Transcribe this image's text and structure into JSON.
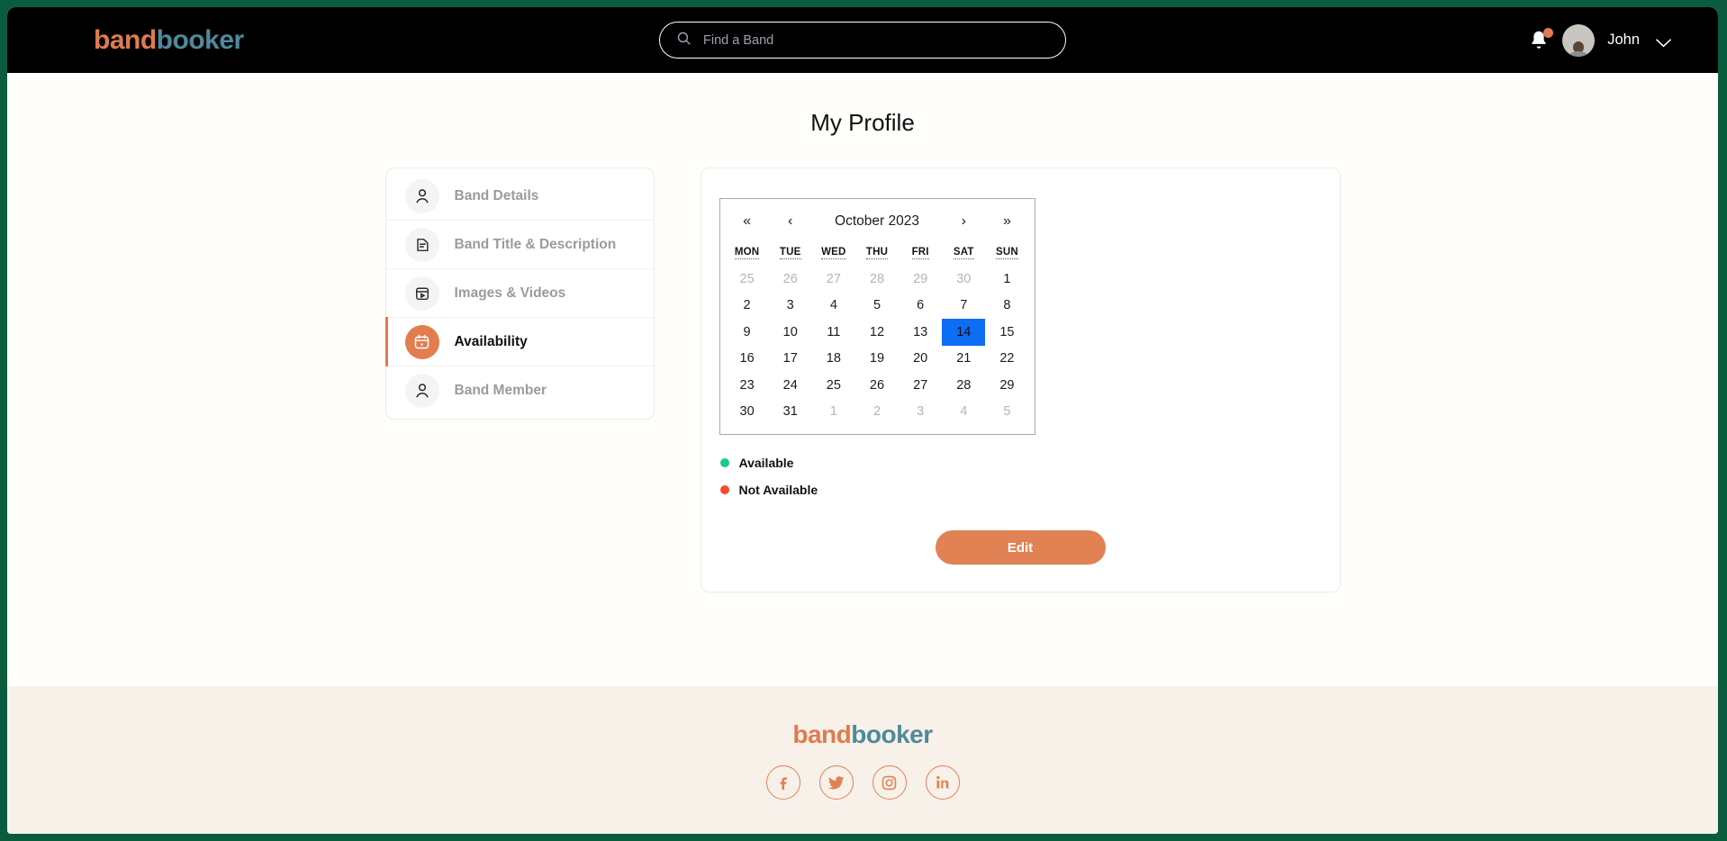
{
  "header": {
    "logo": {
      "part1": "band",
      "part2": "booker"
    },
    "search": {
      "value": "",
      "placeholder": "Find a Band"
    },
    "bell_icon": "bell-icon",
    "notification_dot": true,
    "username": "John",
    "chevron_icon": "chevron-down-icon"
  },
  "page": {
    "title": "My Profile"
  },
  "sidebar": {
    "items": [
      {
        "label": "Band Details",
        "icon": "user-icon",
        "active": false
      },
      {
        "label": "Band Title & Description",
        "icon": "document-icon",
        "active": false
      },
      {
        "label": "Images & Videos",
        "icon": "media-calendar-icon",
        "active": false
      },
      {
        "label": "Availability",
        "icon": "calendar-icon",
        "active": true
      },
      {
        "label": "Band Member",
        "icon": "user-icon",
        "active": false
      }
    ]
  },
  "calendar": {
    "nav": {
      "first": "«",
      "prev": "‹",
      "next": "›",
      "last": "»"
    },
    "month_label": "October 2023",
    "weekdays": [
      "MON",
      "TUE",
      "WED",
      "THU",
      "FRI",
      "SAT",
      "SUN"
    ],
    "selected_day": 14,
    "selected_color": "#0B6EF5",
    "weeks": [
      [
        {
          "d": "25",
          "muted": true
        },
        {
          "d": "26",
          "muted": true
        },
        {
          "d": "27",
          "muted": true
        },
        {
          "d": "28",
          "muted": true
        },
        {
          "d": "29",
          "muted": true
        },
        {
          "d": "30",
          "muted": true
        },
        {
          "d": "1",
          "muted": false
        }
      ],
      [
        {
          "d": "2",
          "muted": false
        },
        {
          "d": "3",
          "muted": false
        },
        {
          "d": "4",
          "muted": false
        },
        {
          "d": "5",
          "muted": false
        },
        {
          "d": "6",
          "muted": false
        },
        {
          "d": "7",
          "muted": false
        },
        {
          "d": "8",
          "muted": false
        }
      ],
      [
        {
          "d": "9",
          "muted": false
        },
        {
          "d": "10",
          "muted": false
        },
        {
          "d": "11",
          "muted": false
        },
        {
          "d": "12",
          "muted": false
        },
        {
          "d": "13",
          "muted": false
        },
        {
          "d": "14",
          "muted": false,
          "selected": true
        },
        {
          "d": "15",
          "muted": false
        }
      ],
      [
        {
          "d": "16",
          "muted": false
        },
        {
          "d": "17",
          "muted": false
        },
        {
          "d": "18",
          "muted": false
        },
        {
          "d": "19",
          "muted": false
        },
        {
          "d": "20",
          "muted": false
        },
        {
          "d": "21",
          "muted": false
        },
        {
          "d": "22",
          "muted": false
        }
      ],
      [
        {
          "d": "23",
          "muted": false
        },
        {
          "d": "24",
          "muted": false
        },
        {
          "d": "25",
          "muted": false
        },
        {
          "d": "26",
          "muted": false
        },
        {
          "d": "27",
          "muted": false
        },
        {
          "d": "28",
          "muted": false
        },
        {
          "d": "29",
          "muted": false
        }
      ],
      [
        {
          "d": "30",
          "muted": false
        },
        {
          "d": "31",
          "muted": false
        },
        {
          "d": "1",
          "muted": true
        },
        {
          "d": "2",
          "muted": true
        },
        {
          "d": "3",
          "muted": true
        },
        {
          "d": "4",
          "muted": true
        },
        {
          "d": "5",
          "muted": true
        }
      ]
    ]
  },
  "legend": [
    {
      "label": "Available",
      "color": "#16C98D"
    },
    {
      "label": "Not Available",
      "color": "#F9482C"
    }
  ],
  "actions": {
    "edit_label": "Edit",
    "edit_color": "#E08253"
  },
  "footer": {
    "logo": {
      "part1": "band",
      "part2": "booker"
    },
    "socials": [
      {
        "name": "facebook-icon",
        "glyph": "f"
      },
      {
        "name": "twitter-icon",
        "glyph": "t"
      },
      {
        "name": "instagram-icon",
        "glyph": "i"
      },
      {
        "name": "linkedin-icon",
        "glyph": "in"
      }
    ]
  },
  "theme": {
    "frame": "#0a5c3f",
    "header_bg": "#000000",
    "accent_orange": "#E07B4F",
    "accent_teal": "#4E8A9B",
    "footer_bg": "#F7F1EA"
  }
}
